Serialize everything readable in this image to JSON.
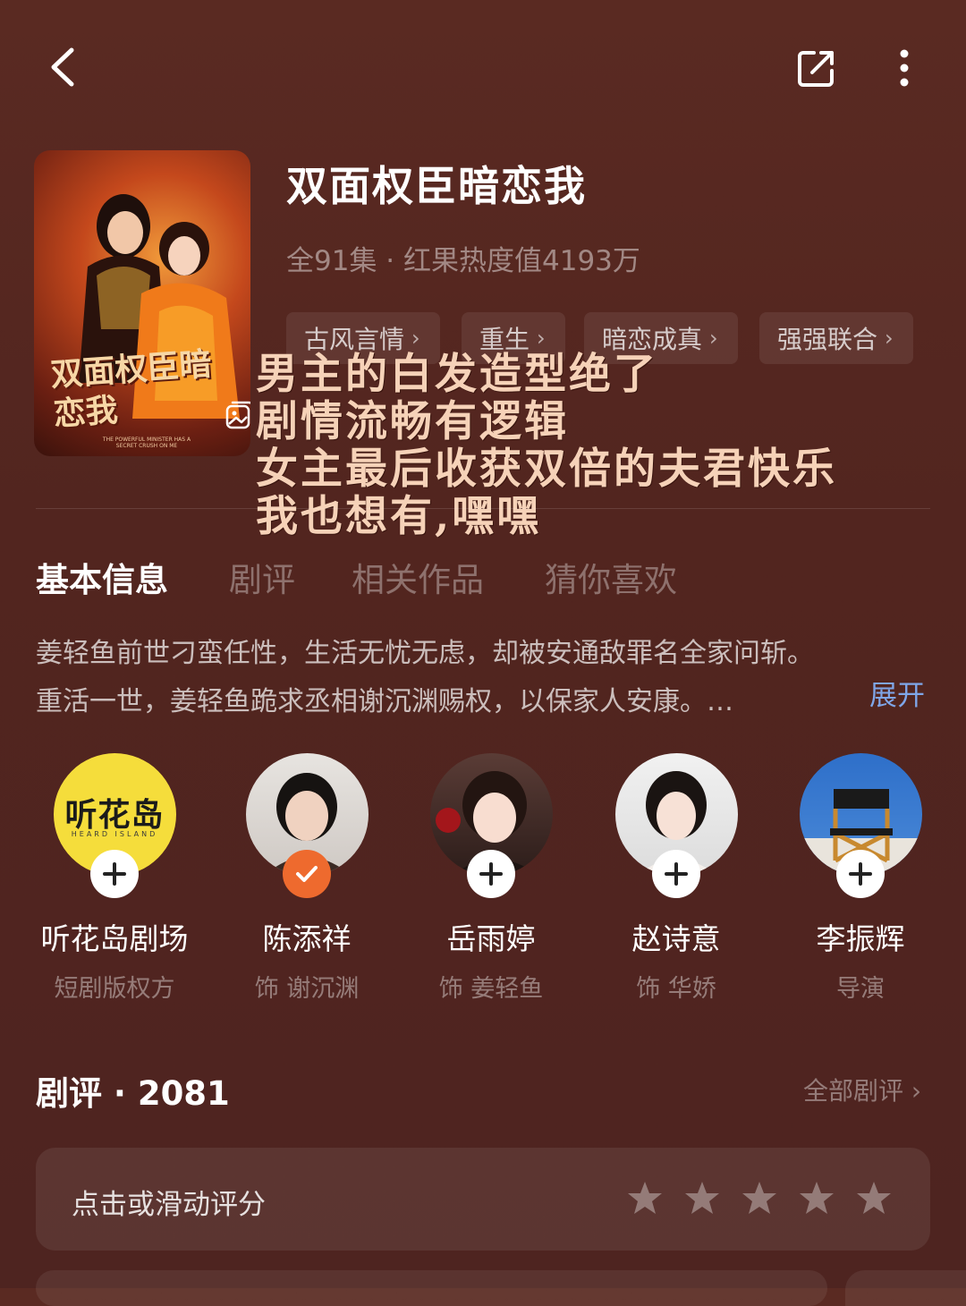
{
  "header": {
    "back_icon": "chevron-left-icon",
    "share_icon": "share-icon",
    "more_icon": "more-vertical-icon"
  },
  "poster": {
    "title_art": "双面权臣暗恋我",
    "subtitle_art": "THE POWERFUL MINISTER HAS A SECRET CRUSH ON ME",
    "gallery_icon": "gallery-icon"
  },
  "drama": {
    "title": "双面权臣暗恋我",
    "meta": "全91集 · 红果热度值4193万",
    "tags": [
      "古风言情",
      "重生",
      "暗恋成真",
      "强强联合"
    ]
  },
  "overlay_text": {
    "lines": [
      "男主的白发造型绝了",
      "剧情流畅有逻辑",
      "女主最后收获双倍的夫君快乐",
      "我也想有,嘿嘿"
    ]
  },
  "tabs": [
    "基本信息",
    "剧评",
    "相关作品",
    "猜你喜欢"
  ],
  "active_tab": "基本信息",
  "synopsis": {
    "line1": "姜轻鱼前世刁蛮任性，生活无忧无虑，却被安通敌罪名全家问斩。",
    "line2": "重活一世，姜轻鱼跪求丞相谢沉渊赐权，以保家人安康。…",
    "expand_label": "展开"
  },
  "cast": [
    {
      "name": "听花岛剧场",
      "role": "短剧版权方",
      "followed": false,
      "avatar_text": "听花岛",
      "avatar_sub": "HEARD ISLAND"
    },
    {
      "name": "陈添祥",
      "role": "饰 谢沉渊",
      "followed": true
    },
    {
      "name": "岳雨婷",
      "role": "饰 姜轻鱼",
      "followed": false
    },
    {
      "name": "赵诗意",
      "role": "饰 华娇",
      "followed": false
    },
    {
      "name": "李振辉",
      "role": "导演",
      "followed": false
    }
  ],
  "reviews": {
    "title": "剧评 · 2081",
    "all_label": "全部剧评",
    "rating_prompt": "点击或滑动评分",
    "rating_value": 0,
    "rating_max": 5
  },
  "colors": {
    "background": "#55271f",
    "accent_link": "#7fa6e8",
    "follow_badge": "#ee6a2e",
    "overlay_text": "#f6d2b8"
  }
}
